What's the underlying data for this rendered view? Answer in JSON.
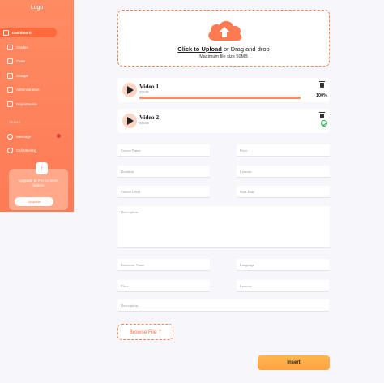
{
  "sidebar": {
    "logo": "Logo",
    "items": [
      {
        "label": "Dashboard",
        "icon": "grid-icon"
      },
      {
        "label": "Grades",
        "icon": "chart-icon"
      },
      {
        "label": "Class",
        "icon": "book-icon"
      },
      {
        "label": "Groups",
        "icon": "users-icon"
      },
      {
        "label": "Administration",
        "icon": "calendar-icon"
      },
      {
        "label": "Departments",
        "icon": "building-icon"
      }
    ],
    "section_label": "TEAMS",
    "team_items": [
      {
        "label": "Message",
        "icon": "chat-icon"
      },
      {
        "label": "Call Meeting",
        "icon": "phone-icon"
      }
    ],
    "upgrade": {
      "text": "Upgrade to Pro for more feature",
      "button": "Upgrade"
    }
  },
  "upload": {
    "link_text": "Click to Upload",
    "rest_text": "or Drag and drop",
    "sub_text": "Maximum file size 50MB"
  },
  "videos": [
    {
      "title": "Video 1",
      "size": "20MB",
      "progress_pct": 100,
      "progress_label": "100%"
    },
    {
      "title": "Video 2",
      "size": "20MB",
      "status": "complete"
    }
  ],
  "form": {
    "course_name": "Course Name",
    "price": "Price",
    "duration": "Duration",
    "lessons": "Lessons",
    "course_level": "Course Level",
    "start_date": "Start Date",
    "description": "Description...",
    "instructor_name": "Instructor Name",
    "language": "Language",
    "place": "Place",
    "lessons2": "Lessons",
    "description2": "Description..."
  },
  "browse_label": "Browse File",
  "insert_label": "Insert",
  "colors": {
    "accent": "#fd7b55",
    "insert": "#ffa245",
    "success": "#2fb34a"
  }
}
